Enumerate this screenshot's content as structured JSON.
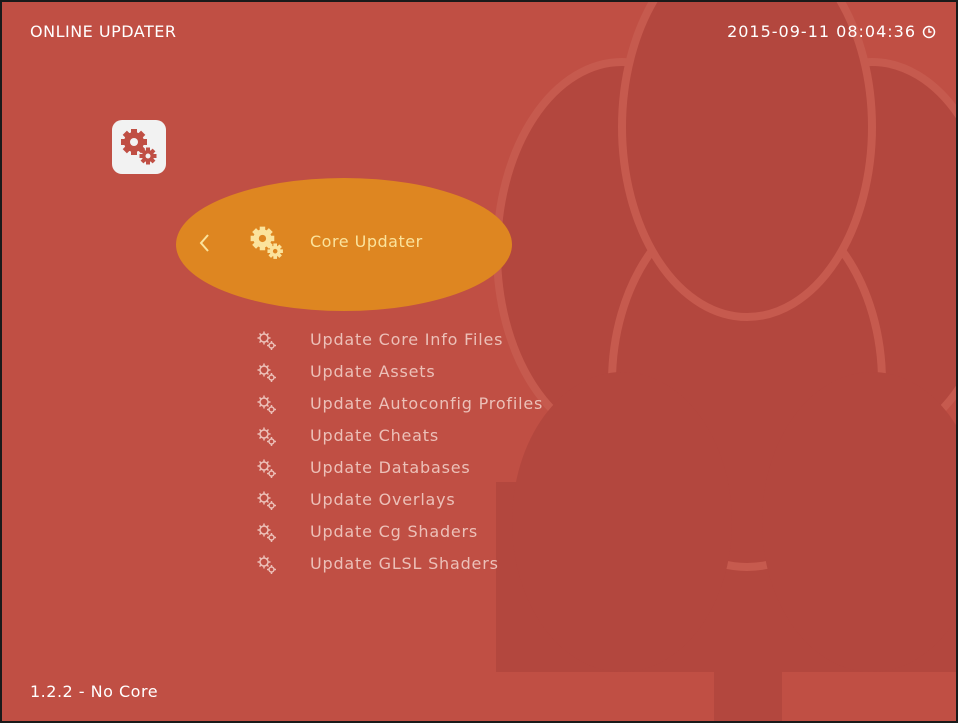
{
  "header": {
    "title": "ONLINE UPDATER",
    "datetime": "2015-09-11 08:04:36",
    "clock_icon": "clock-icon"
  },
  "tab_icon": {
    "icon": "gears-icon"
  },
  "selected_item": {
    "back_icon": "chevron-left-icon",
    "icon": "gears-icon",
    "label": "Core Updater"
  },
  "menu": {
    "items": [
      {
        "label": "Update Core Info Files",
        "icon": "gears-icon"
      },
      {
        "label": "Update Assets",
        "icon": "gears-icon"
      },
      {
        "label": "Update Autoconfig Profiles",
        "icon": "gears-icon"
      },
      {
        "label": "Update Cheats",
        "icon": "gears-icon"
      },
      {
        "label": "Update Databases",
        "icon": "gears-icon"
      },
      {
        "label": "Update Overlays",
        "icon": "gears-icon"
      },
      {
        "label": "Update Cg Shaders",
        "icon": "gears-icon"
      },
      {
        "label": "Update GLSL Shaders",
        "icon": "gears-icon"
      }
    ]
  },
  "footer": {
    "version": "1.2.2 - No Core"
  },
  "colors": {
    "background": "#c04f44",
    "selection": "#de8621",
    "selected_text": "#fbe39c",
    "menu_text": "#ecc0b8"
  }
}
